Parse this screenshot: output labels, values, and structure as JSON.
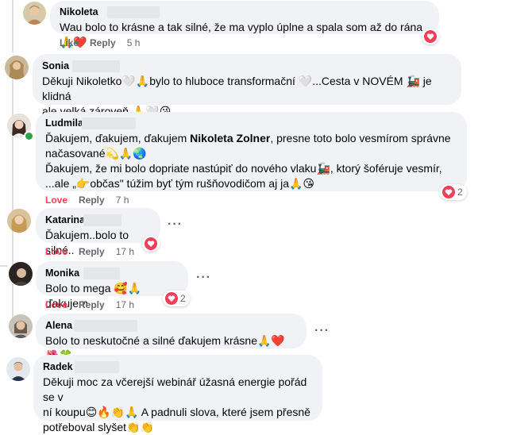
{
  "colors": {
    "bubble_bg": "#f0f2f5",
    "meta_text": "#65676b",
    "love_red": "#f33e58",
    "online_green": "#31a24c"
  },
  "comments": [
    {
      "author": "Nikoleta",
      "lines": [
        "Wau bolo to krásne a tak silné, že ma vyplo úplne a spala som až do rána 🙏❤️"
      ],
      "actions": {
        "like": "Like",
        "reply": "Reply",
        "time": "5 h"
      },
      "reaction": {
        "icon": "heart-icon",
        "count": ""
      }
    },
    {
      "author": "Sonia",
      "lines": [
        "Děkuji Nikoletko🤍🙏bylo to hluboce transformační 🤍...Cesta v NOVÉM 🚂 je klidná",
        "ale velká zároveň 🙏🤍😘"
      ]
    },
    {
      "author": "Ludmila",
      "lines_html_parts": {
        "l1_a": "Ďakujem, ďakujem, ďakujem ",
        "l1_b": "Nikoleta Zolner",
        "l1_c": ", presne toto bolo vesmírom správne",
        "l2": "načasované💫🙏🌏",
        "l3": "Ďakujem, že mi bolo dopriate nastúpiť do nového vlaku🚂, ktorý šoféruje vesmír,",
        "l4": "...ale „👉občas\" túžim byť tým rušňovodičom aj ja🙏😘"
      },
      "actions": {
        "like": "Love",
        "reply": "Reply",
        "time": "7 h"
      },
      "reaction": {
        "icon": "heart-icon",
        "count": "2"
      }
    },
    {
      "author": "Katarina",
      "lines": [
        "Ďakujem..bolo to silné.."
      ],
      "actions": {
        "like": "Love",
        "reply": "Reply",
        "time": "17 h"
      },
      "reaction": {
        "icon": "heart-icon",
        "count": ""
      }
    },
    {
      "author": "Monika",
      "lines": [
        "Bolo to mega 🥰🙏 ďakujem"
      ],
      "actions": {
        "like": "Love",
        "reply": "Reply",
        "time": "17 h"
      },
      "reaction": {
        "icon": "heart-icon",
        "count": "2"
      }
    },
    {
      "author": "Alena",
      "lines": [
        "Bolo to neskutočné a silné ďakujem krásne🙏❤️🌺🍀"
      ]
    },
    {
      "author": "Radek",
      "lines": [
        "Děkuji moc za včerejší webinář úžasná energie pořád se v",
        "ní koupu😊🔥👏🙏 A padnuli slova, které jsem přesně",
        "potřeboval slyšet👏👏"
      ]
    }
  ]
}
